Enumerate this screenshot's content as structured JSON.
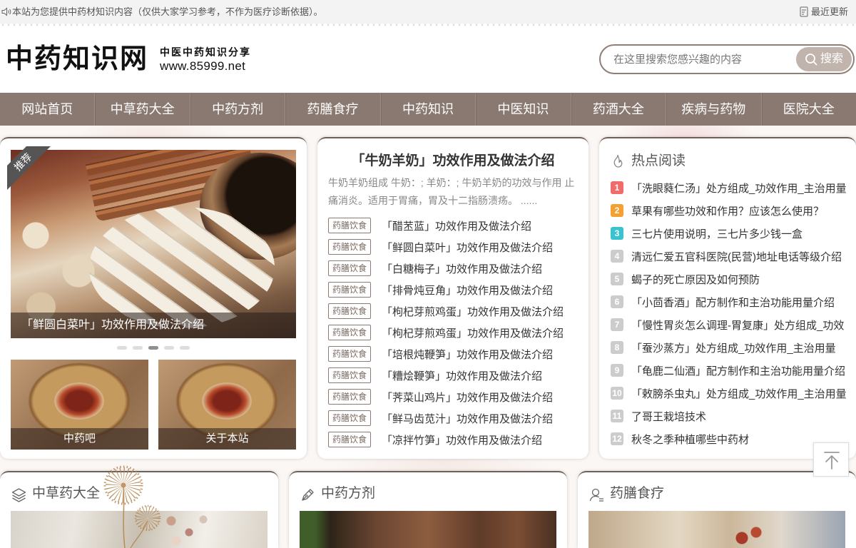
{
  "topbar": {
    "notice": "本站为您提供中药材知识内容（仅供大家学习参考，不作为医疗诊断依据）。",
    "recent": "最近更新"
  },
  "header": {
    "logo": "中药知识网",
    "tagline": "中医中药知识分享",
    "domain": "www.85999.net"
  },
  "search": {
    "placeholder": "在这里搜索您感兴趣的内容",
    "button": "搜索"
  },
  "nav": [
    "网站首页",
    "中草药大全",
    "中药方剂",
    "药膳食疗",
    "中药知识",
    "中医知识",
    "药酒大全",
    "疾病与药物",
    "医院大全"
  ],
  "slider": {
    "badge": "推荐",
    "caption": "「鲜圆白菜叶」功效作用及做法介绍",
    "pages": 5,
    "active_page": 3
  },
  "thumbs": [
    {
      "label": "中药吧"
    },
    {
      "label": "关于本站"
    }
  ],
  "featured": {
    "title": "「牛奶羊奶」功效作用及做法介绍",
    "summary": "牛奶羊奶组成 牛奶：; 羊奶：; 牛奶羊奶的功效与作用 止痛消炎。适用于胃痛，胃及十二指肠溃疡。 ......",
    "items": [
      {
        "tag": "药膳饮食",
        "title": "「醋苤蓝」功效作用及做法介绍"
      },
      {
        "tag": "药膳饮食",
        "title": "「鲜圆白菜叶」功效作用及做法介绍"
      },
      {
        "tag": "药膳饮食",
        "title": "「白糖梅子」功效作用及做法介绍"
      },
      {
        "tag": "药膳饮食",
        "title": "「排骨炖豆角」功效作用及做法介绍"
      },
      {
        "tag": "药膳饮食",
        "title": "「枸杞芽煎鸡蛋」功效作用及做法介绍"
      },
      {
        "tag": "药膳饮食",
        "title": "「枸杞芽煎鸡蛋」功效作用及做法介绍"
      },
      {
        "tag": "药膳饮食",
        "title": "「培根炖鞭笋」功效作用及做法介绍"
      },
      {
        "tag": "药膳饮食",
        "title": "「糟烩鞭笋」功效作用及做法介绍"
      },
      {
        "tag": "药膳饮食",
        "title": "「荠菜山鸡片」功效作用及做法介绍"
      },
      {
        "tag": "药膳饮食",
        "title": "「鲜马齿苋汁」功效作用及做法介绍"
      },
      {
        "tag": "药膳饮食",
        "title": "「凉拌竹笋」功效作用及做法介绍"
      }
    ]
  },
  "hot": {
    "title": "热点阅读",
    "items": [
      {
        "rank": "1",
        "title": "「洗眼蕤仁汤」处方组成_功效作用_主治用量"
      },
      {
        "rank": "2",
        "title": "草果有哪些功效和作用？应该怎么使用？"
      },
      {
        "rank": "3",
        "title": "三七片使用说明，三七片多少钱一盒"
      },
      {
        "rank": "4",
        "title": "清远仁爱五官科医院(民营)地址电话等级介绍"
      },
      {
        "rank": "5",
        "title": "蝎子的死亡原因及如何预防"
      },
      {
        "rank": "6",
        "title": "「小茴香酒」配方制作和主治功能用量介绍"
      },
      {
        "rank": "7",
        "title": "「慢性胃炎怎么调理-胃复康」处方组成_功效"
      },
      {
        "rank": "8",
        "title": "「蚕沙蒸方」处方组成_功效作用_主治用量"
      },
      {
        "rank": "9",
        "title": "「龟鹿二仙酒」配方制作和主治功能用量介绍"
      },
      {
        "rank": "10",
        "title": "「敕膀杀虫丸」处方组成_功效作用_主治用量"
      },
      {
        "rank": "11",
        "title": "了哥王栽培技术"
      },
      {
        "rank": "12",
        "title": "秋冬之季种植哪些中药材"
      }
    ]
  },
  "sections": [
    {
      "title": "中草药大全",
      "icon": "layers-icon"
    },
    {
      "title": "中药方剂",
      "icon": "pen-icon"
    },
    {
      "title": "药膳食疗",
      "icon": "user-icon"
    }
  ],
  "icons": {
    "notice": "speaker-icon",
    "recent": "document-icon",
    "search": "search-icon",
    "hot": "flame-icon",
    "back_to_top": "arrow-up-icon"
  },
  "colors": {
    "nav_bg": "#8a7970",
    "tag": "#8b7b73",
    "rank": [
      "#f26b6b",
      "#f5a033",
      "#38c3cf"
    ],
    "rank_default": "#cccccc"
  }
}
